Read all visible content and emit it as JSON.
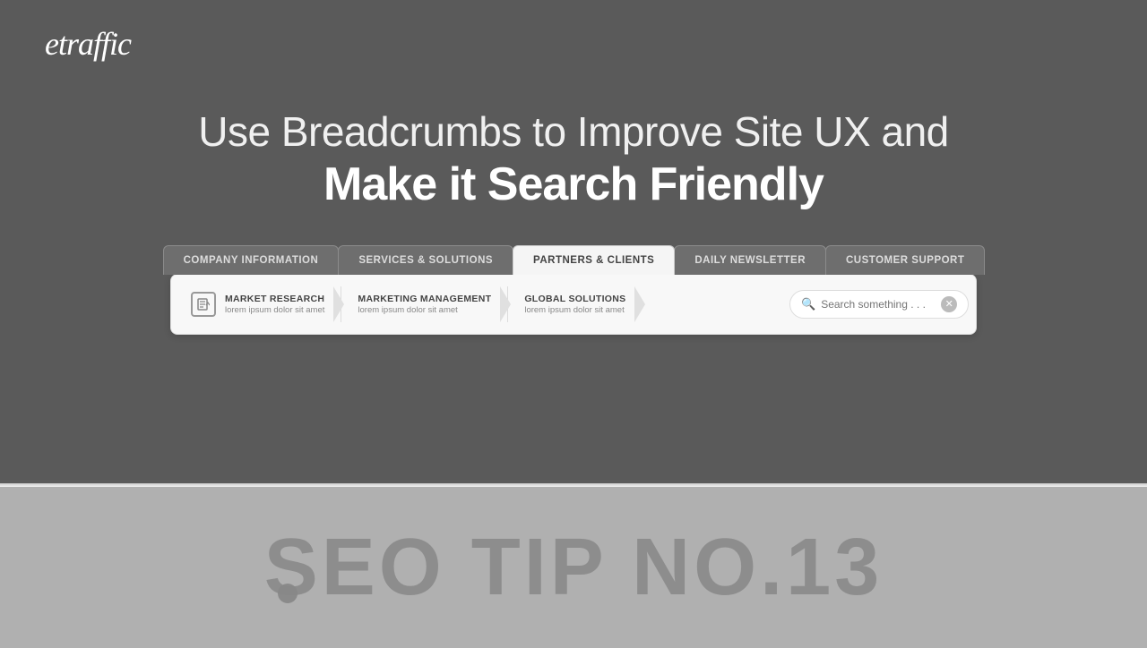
{
  "logo": {
    "text": "etraffic"
  },
  "headline": {
    "line1": "Use Breadcrumbs to Improve Site UX and",
    "line2": "Make it Search Friendly"
  },
  "nav": {
    "tabs": [
      {
        "id": "company",
        "label": "COMPANY INFORMATION",
        "active": false
      },
      {
        "id": "services",
        "label": "SERVICES & SOLUTIONS",
        "active": false
      },
      {
        "id": "partners",
        "label": "PARTNERS & CLIENTS",
        "active": true
      },
      {
        "id": "newsletter",
        "label": "DAILY NEWSLETTER",
        "active": false
      },
      {
        "id": "support",
        "label": "CUSTOMER SUPPORT",
        "active": false
      }
    ]
  },
  "breadcrumbs": {
    "items": [
      {
        "title": "MARKET RESEARCH",
        "subtitle": "lorem ipsum dolor sit amet",
        "has_icon": true
      },
      {
        "title": "MARKETING MANAGEMENT",
        "subtitle": "lorem ipsum dolor sit amet",
        "has_icon": false
      },
      {
        "title": "GLOBAL SOLUTIONS",
        "subtitle": "lorem ipsum dolor sit amet",
        "has_icon": false
      }
    ],
    "search": {
      "placeholder": "Search something . . ."
    }
  },
  "bottom": {
    "seo_tip": "SEO TIP NO.13"
  }
}
